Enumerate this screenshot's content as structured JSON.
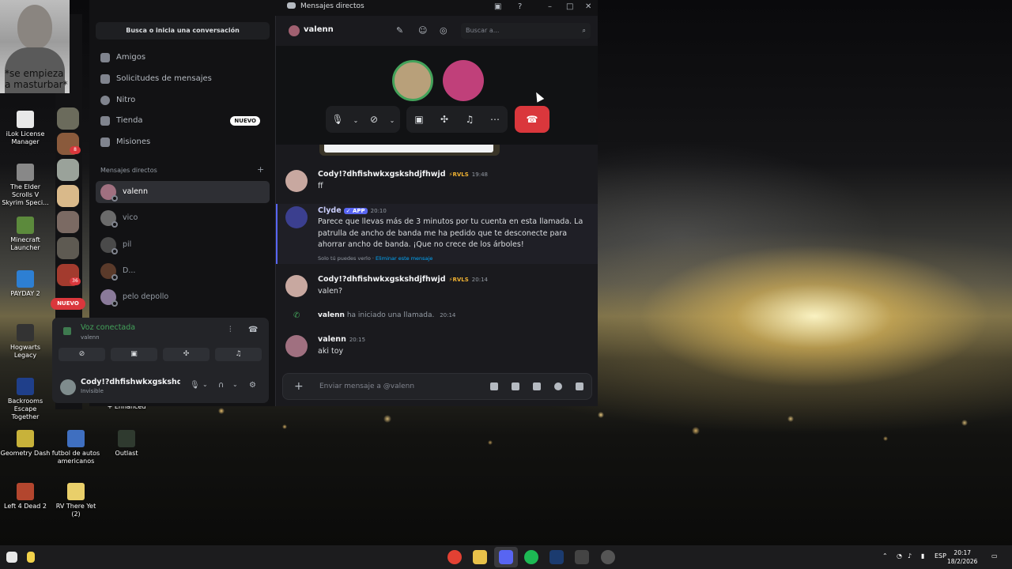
{
  "webcam": {
    "caption": "*se empieza a masturbar*"
  },
  "desktop_icons": [
    {
      "label": "iLok License Manager"
    },
    {
      "label": "The Elder Scrolls V Skyrim Speci..."
    },
    {
      "label": "Minecraft Launcher"
    },
    {
      "label": "PAYDAY 2"
    },
    {
      "label": "Hogwarts Legacy"
    },
    {
      "label": "Backrooms Escape Together"
    },
    {
      "label": "Geometry Dash"
    },
    {
      "label": "futbol de autos americanos"
    },
    {
      "label": "Outlast"
    },
    {
      "label": "Left 4 Dead 2"
    },
    {
      "label": "RV There Yet (2)"
    },
    {
      "label": "+ Enhanced"
    }
  ],
  "rail": {
    "badges": [
      "8",
      "36"
    ],
    "nuevo": "NUEVO"
  },
  "window": {
    "title": "Mensajes directos"
  },
  "sidebar": {
    "search": "Busca o inicia una conversación",
    "nav": [
      {
        "label": "Amigos"
      },
      {
        "label": "Solicitudes de mensajes"
      },
      {
        "label": "Nitro"
      },
      {
        "label": "Tienda",
        "badge": "NUEVO"
      },
      {
        "label": "Misiones"
      }
    ],
    "dm_header": "Mensajes directos",
    "dms": [
      {
        "name": "valenn"
      },
      {
        "name": "vico"
      },
      {
        "name": "pil"
      },
      {
        "name": "D..."
      },
      {
        "name": "pelo depollo"
      }
    ]
  },
  "voice": {
    "title": "Voz conectada",
    "channel": "valenn",
    "user_name": "Cody!?dhfishwkxgskshdj...",
    "user_status": "Invisible"
  },
  "chat": {
    "recipient": "valenn",
    "search_placeholder": "Buscar a...",
    "composer_placeholder": "Enviar mensaje a @valenn",
    "messages": [
      {
        "author": "Cody!?dhfishwkxgskshdjfhwjd",
        "tag": "⚡RVLS",
        "time": "19:48",
        "text": "ff"
      },
      {
        "author": "Clyde",
        "tag": "✓ APP",
        "time": "20:10",
        "text": "Parece que llevas más de 3 minutos por tu cuenta en esta llamada. La patrulla de ancho de banda me ha pedido que te desconecte para ahorrar ancho de banda. ¡Que no crece de los árboles!",
        "ephemeral": "Solo tú puedes verlo · ",
        "ephemeral_link": "Eliminar este mensaje"
      },
      {
        "author": "Cody!?dhfishwkxgskshdjfhwjd",
        "tag": "⚡RVLS",
        "time": "20:14",
        "text": "valen?"
      },
      {
        "system_user": "valenn",
        "system_text": " ha iniciado una llamada.",
        "time": "20:14"
      },
      {
        "author": "valenn",
        "time": "20:15",
        "text": "aki toy"
      }
    ]
  },
  "taskbar": {
    "lang": "ESP",
    "time": "20:17",
    "date": "18/2/2026"
  },
  "colors": {
    "discord_bg": "#1a1a1e",
    "sidebar_bg": "#121214",
    "accent_green": "#43a25a",
    "danger": "#da373c",
    "blurple": "#5865f2"
  }
}
